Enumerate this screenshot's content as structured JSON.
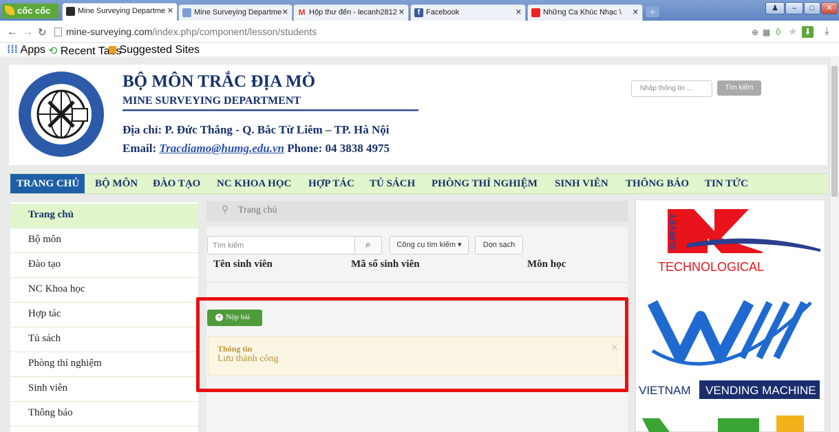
{
  "browser": {
    "brand": "cốc cốc",
    "tabs": [
      {
        "title": "Mine Surveying Departme",
        "active": true
      },
      {
        "title": "Mine Surveying Departme",
        "active": false
      },
      {
        "title": "Hộp thư đến - lecanh2812",
        "active": false
      },
      {
        "title": "Facebook",
        "active": false
      },
      {
        "title": "Những Ca Khúc Nhạc \\",
        "active": false
      }
    ],
    "url_domain": "mine-surveying.com",
    "url_path": "/index.php/component/lesson/students",
    "bookmarks": [
      "Apps",
      "Recent Tabs",
      "Suggested Sites"
    ]
  },
  "header": {
    "title": "BỘ MÔN TRẮC ĐỊA MỎ",
    "subtitle": "MINE SURVEYING DEPARTMENT",
    "address": "Địa chỉ: P. Đức Thắng - Q. Bắc Từ Liêm – TP. Hà Nội",
    "email_label": "Email:",
    "email": "Tracdiamo@humg.edu.vn",
    "phone": "Phone: 04 3838 4975",
    "search_placeholder": "Nhập thông tin ...",
    "search_button": "Tìm kiếm"
  },
  "nav": [
    "TRANG CHỦ",
    "BỘ MÔN",
    "ĐÀO TẠO",
    "NC KHOA HỌC",
    "HỢP TÁC",
    "TỦ SÁCH",
    "PHÒNG THÍ NGHIỆM",
    "SINH VIÊN",
    "THÔNG BÁO",
    "TIN TỨC"
  ],
  "sidebar": [
    "Trang chủ",
    "Bộ môn",
    "Đào tạo",
    "NC Khoa học",
    "Hợp tác",
    "Tủ sách",
    "Phòng thí nghiệm",
    "Sinh viên",
    "Thông báo"
  ],
  "main": {
    "breadcrumb": "Trang chủ",
    "search_placeholder": "Tìm kiếm",
    "tools_button": "Công cụ tìm kiếm ▾",
    "clear_button": "Dọn sạch",
    "columns": [
      "Tên sinh viên",
      "Mã số sinh viên",
      "Môn học"
    ],
    "submit_button": "Nộp bài",
    "alert_title": "Thông tin",
    "alert_message": "Lưu thành công"
  },
  "ads": {
    "ad1_side": "SURVEY",
    "ad1_text": "TECHNOLOGICAL",
    "ad2_text1": "VIETNAM",
    "ad2_text2": "VENDING MACHINE"
  },
  "colors": {
    "nav_bg": "#e2f5cc",
    "nav_active": "#1f5fa8",
    "highlight": "#e81010",
    "submit": "#4e9b3b"
  }
}
